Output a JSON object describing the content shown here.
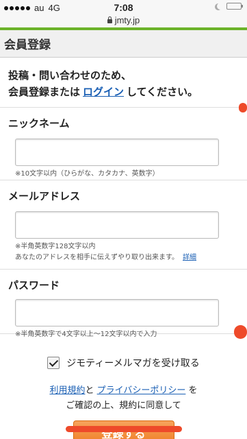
{
  "status_bar": {
    "carrier": "au",
    "network": "4G",
    "time": "7:08",
    "url": "jmty.jp"
  },
  "header": {
    "title": "会員登録"
  },
  "intro": {
    "line1": "投稿・問い合わせのため、",
    "line2_prefix": "会員登録または",
    "login_link": "ログイン",
    "line2_suffix": "してください。"
  },
  "form": {
    "nickname": {
      "label": "ニックネーム",
      "value": "",
      "hint": "※10文字以内（ひらがな、カタカナ、英数字）"
    },
    "email": {
      "label": "メールアドレス",
      "value": "",
      "hint1": "※半角英数字128文字以内",
      "hint2": "あなたのアドレスを相手に伝えずやり取り出来ます。",
      "details_link": "詳細"
    },
    "password": {
      "label": "パスワード",
      "value": "",
      "hint": "※半角英数字で4文字以上〜12文字以内で入力"
    },
    "newsletter": {
      "label": "ジモティーメルマガを受け取る",
      "checked": true
    }
  },
  "terms": {
    "terms_link": "利用規約",
    "and": "と",
    "privacy_link": "プライバシーポリシー",
    "suffix": "を",
    "line2": "ご確認の上、規約に同意して"
  },
  "submit_label": "登録する",
  "colors": {
    "accent_green": "#6cb32a",
    "link_blue": "#1a5fb4",
    "button_orange": "#ee7a1e",
    "marker_red": "#ee4a2a"
  }
}
